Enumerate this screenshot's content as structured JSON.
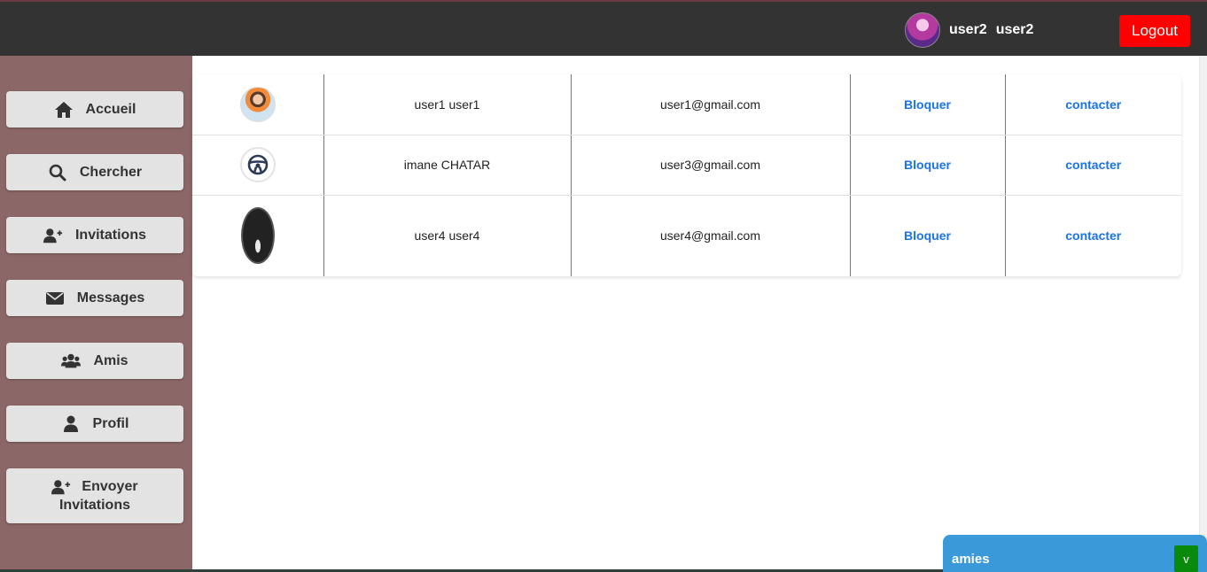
{
  "header": {
    "user_first": "user2",
    "user_last": "user2",
    "logout_label": "Logout"
  },
  "sidebar": {
    "items": [
      {
        "label": "Accueil",
        "icon": "home-icon"
      },
      {
        "label": "Chercher",
        "icon": "search-icon"
      },
      {
        "label": "Invitations",
        "icon": "user-plus-icon"
      },
      {
        "label": "Messages",
        "icon": "envelope-icon"
      },
      {
        "label": "Amis",
        "icon": "users-icon"
      },
      {
        "label": "Profil",
        "icon": "user-icon"
      },
      {
        "label_line1": "Envoyer",
        "label_line2": "Invitations",
        "icon": "user-plus-icon"
      }
    ]
  },
  "friends": [
    {
      "name": "user1 user1",
      "email": "user1@gmail.com",
      "block_label": "Bloquer",
      "contact_label": "contacter"
    },
    {
      "name": "imane CHATAR",
      "email": "user3@gmail.com",
      "block_label": "Bloquer",
      "contact_label": "contacter"
    },
    {
      "name": "user4 user4",
      "email": "user4@gmail.com",
      "block_label": "Bloquer",
      "contact_label": "contacter"
    }
  ],
  "chat": {
    "title": "amies",
    "toggle_label": "v"
  },
  "colors": {
    "topbar": "#333333",
    "sidebar": "#8b6767",
    "logout": "#ff0000",
    "link": "#1a73e8",
    "chat": "#3a9ad9",
    "chat_toggle": "#0a8a0a"
  }
}
